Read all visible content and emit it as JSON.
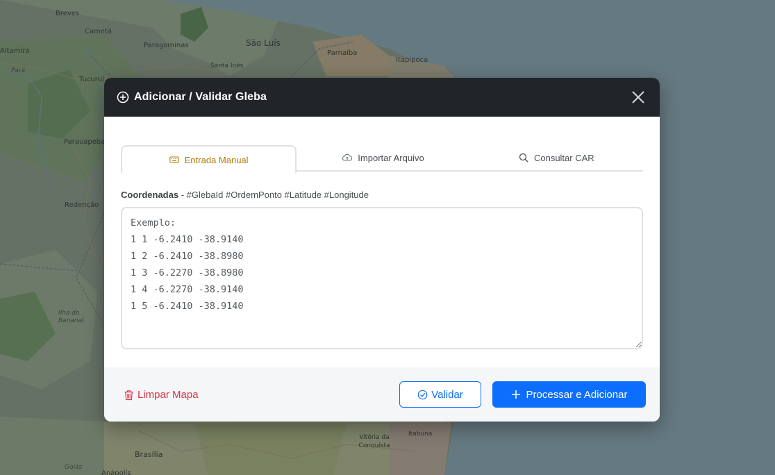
{
  "map": {
    "labels": {
      "breves": "Breves",
      "cameta": "Cametá",
      "paragominas": "Paragominas",
      "sao_luis": "São Luís",
      "parnaiba": "Parnaíba",
      "altamira": "Altamira",
      "para": "Pará",
      "santa_ines": "Santa Inês",
      "itapipoca": "Itapipoca",
      "tucurui": "Tucuruí",
      "parauapebas": "Parauapebas",
      "redencao": "Redenção",
      "ilha_do_bananal": "Ilha do Bananal",
      "vitoria_da_conquista": "Vitória da Conquista",
      "itabuna": "Itabuna",
      "brasilia": "Brasília",
      "goias": "Goiás",
      "anapolis": "Anápolis"
    }
  },
  "modal": {
    "title": "Adicionar / Validar Gleba",
    "tabs": [
      {
        "label": "Entrada Manual",
        "icon": "keyboard-icon",
        "active": true
      },
      {
        "label": "Importar Arquivo",
        "icon": "cloud-upload-icon",
        "active": false
      },
      {
        "label": "Consultar CAR",
        "icon": "search-icon",
        "active": false
      }
    ],
    "coords": {
      "label": "Coordenadas",
      "hint": " - #GlebaId #OrdemPonto #Latitude #Longitude",
      "placeholder": "Exemplo:\n1 1 -6.2410 -38.9140\n1 2 -6.2410 -38.8980\n1 3 -6.2270 -38.8980\n1 4 -6.2270 -38.9140\n1 5 -6.2410 -38.9140",
      "value": ""
    },
    "footer": {
      "clear_label": "Limpar Mapa",
      "validate_label": "Validar",
      "process_label": "Processar e Adicionar"
    }
  },
  "colors": {
    "header_bg": "#212529",
    "active_tab": "#b07a0c",
    "primary": "#0d6efd",
    "danger": "#dc3545"
  }
}
